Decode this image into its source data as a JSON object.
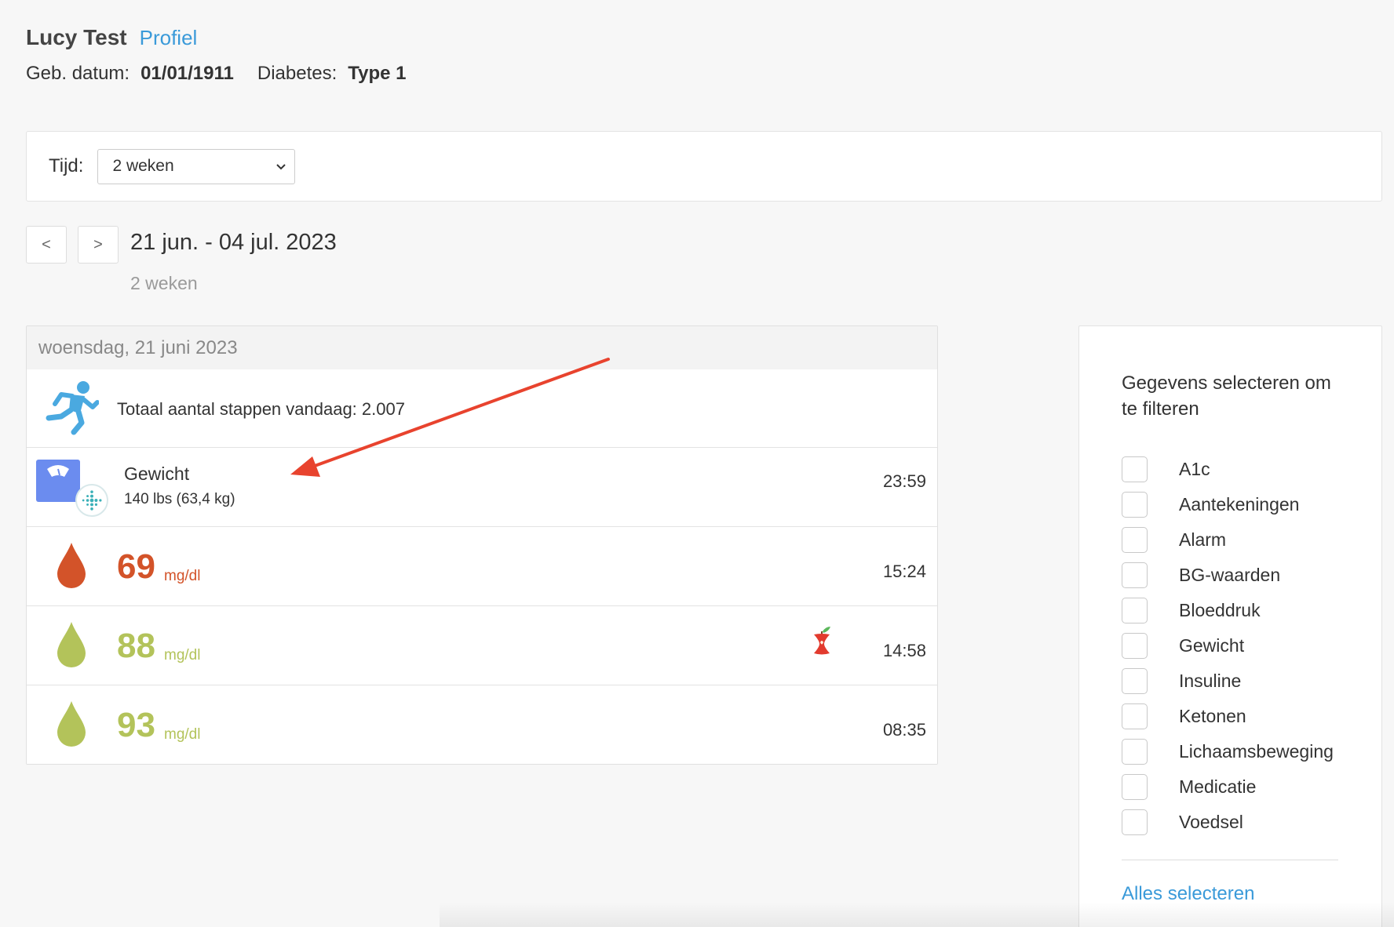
{
  "patient": {
    "name": "Lucy Test",
    "profile_link": "Profiel",
    "dob_label": "Geb. datum:",
    "dob_value": "01/01/1911",
    "diabetes_label": "Diabetes:",
    "diabetes_value": "Type 1"
  },
  "time_filter": {
    "label": "Tijd:",
    "selected": "2 weken"
  },
  "date_nav": {
    "prev_label": "<",
    "next_label": ">",
    "range": "21 jun. - 04 jul. 2023",
    "range_sub": "2 weken"
  },
  "log": {
    "day_header": "woensdag, 21 juni 2023",
    "steps_text": "Totaal aantal stappen vandaag: 2.007",
    "weight": {
      "title": "Gewicht",
      "value": "140 lbs (63,4 kg)",
      "time": "23:59"
    },
    "readings": [
      {
        "value": "69",
        "unit": "mg/dl",
        "time": "15:24",
        "status_color": "#d35329"
      },
      {
        "value": "88",
        "unit": "mg/dl",
        "time": "14:58",
        "status_color": "#b3c35a"
      },
      {
        "value": "93",
        "unit": "mg/dl",
        "time": "08:35",
        "status_color": "#b3c35a"
      }
    ]
  },
  "filter_panel": {
    "title": "Gegevens selecteren om te filteren",
    "options": [
      "A1c",
      "Aantekeningen",
      "Alarm",
      "BG-waarden",
      "Bloeddruk",
      "Gewicht",
      "Insuline",
      "Ketonen",
      "Lichaamsbeweging",
      "Medicatie",
      "Voedsel"
    ],
    "select_all": "Alles selecteren"
  },
  "colors": {
    "link": "#3a9ad9",
    "bg_low": "#d35329",
    "bg_in_range": "#b3c35a",
    "activity_icon": "#4aa9e0",
    "scale_icon": "#6b8cef",
    "annotation_arrow": "#e8432e"
  },
  "icons": [
    "running-person-icon",
    "weighing-scale-icon",
    "fitbit-icon",
    "blood-drop-icon",
    "apple-core-icon",
    "chevron-down-icon"
  ]
}
